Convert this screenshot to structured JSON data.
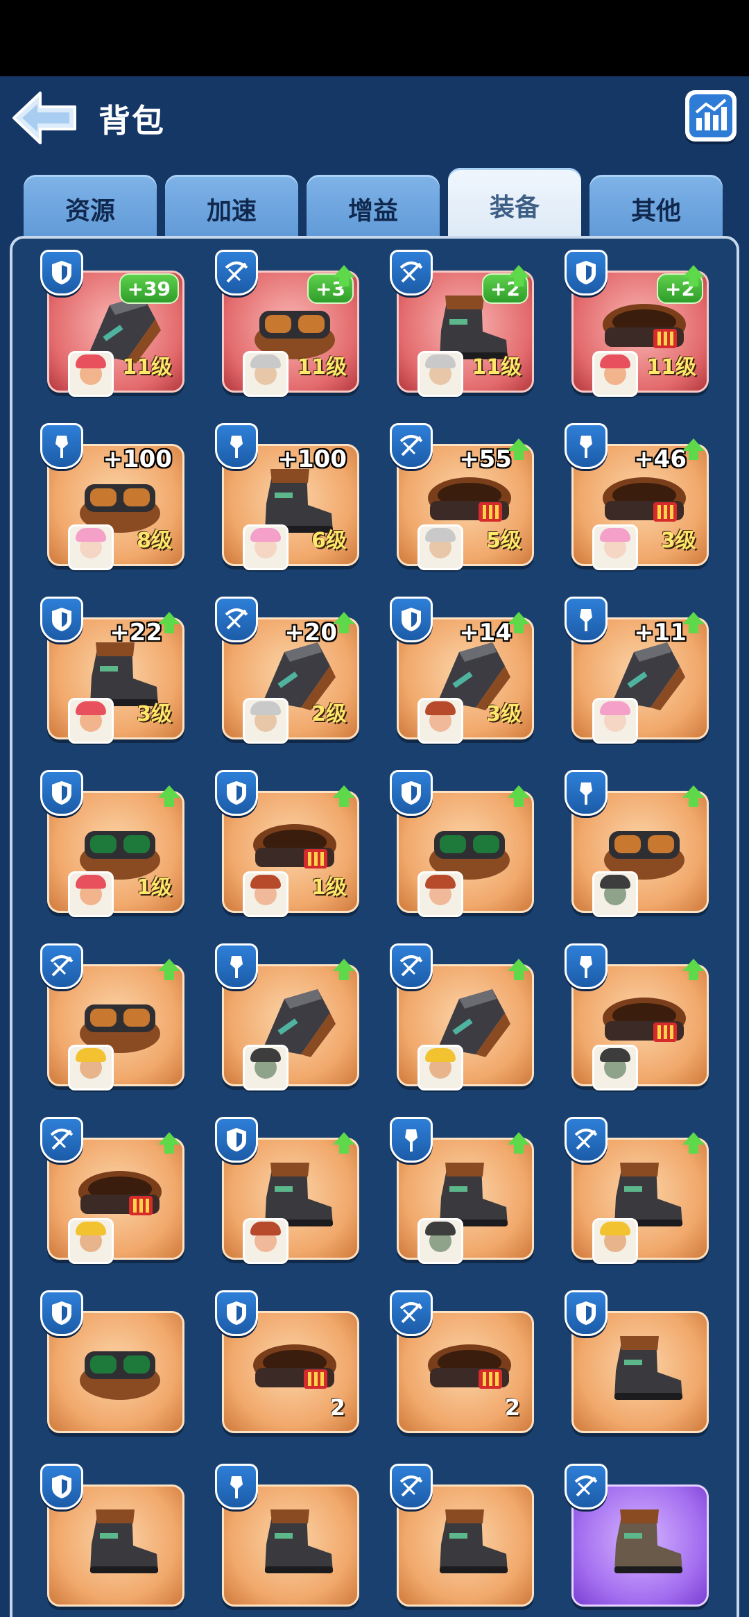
{
  "header": {
    "title": "背包",
    "back_icon": "back-arrow-icon",
    "stats_icon": "bar-chart-icon"
  },
  "tabs": [
    {
      "label": "资源",
      "active": false
    },
    {
      "label": "加速",
      "active": false
    },
    {
      "label": "增益",
      "active": false
    },
    {
      "label": "装备",
      "active": true
    },
    {
      "label": "其他",
      "active": false
    }
  ],
  "colors": {
    "background": "#143766",
    "rarity_red": "#e36a6c",
    "rarity_orange": "#f1a86b",
    "rarity_purple": "#a46ff0",
    "upgrade_green": "#5ed94a",
    "level_yellow": "#ffe76a"
  },
  "items": [
    {
      "slot": "shield",
      "gear": "gauntlet",
      "rarity": "red",
      "bonus": "+39",
      "upgrade": false,
      "hero": "pink-cap",
      "level": "11级"
    },
    {
      "slot": "crossbow",
      "gear": "goggles",
      "rarity": "red",
      "bonus": "+3",
      "upgrade": true,
      "hero": "old-bearded",
      "level": "11级"
    },
    {
      "slot": "crossbow",
      "gear": "boot",
      "rarity": "red",
      "bonus": "+2",
      "upgrade": true,
      "hero": "old-bearded",
      "level": "11级"
    },
    {
      "slot": "shield",
      "gear": "belt",
      "rarity": "red",
      "bonus": "+2",
      "upgrade": true,
      "hero": "pink-cap",
      "level": "11级"
    },
    {
      "slot": "shovel",
      "gear": "goggles",
      "rarity": "orange",
      "bonus": "+100",
      "upgrade": false,
      "hero": "pink-hair",
      "level": "8级"
    },
    {
      "slot": "shovel",
      "gear": "boot",
      "rarity": "orange",
      "bonus": "+100",
      "upgrade": false,
      "hero": "pink-hair",
      "level": "6级"
    },
    {
      "slot": "crossbow",
      "gear": "belt",
      "rarity": "orange",
      "bonus": "+55",
      "upgrade": true,
      "hero": "old-bearded",
      "level": "5级"
    },
    {
      "slot": "shovel",
      "gear": "belt",
      "rarity": "orange",
      "bonus": "+46",
      "upgrade": true,
      "hero": "pink-hair",
      "level": "3级"
    },
    {
      "slot": "shield",
      "gear": "boot",
      "rarity": "orange",
      "bonus": "+22",
      "upgrade": true,
      "hero": "pink-cap",
      "level": "3级"
    },
    {
      "slot": "crossbow",
      "gear": "gauntlet",
      "rarity": "orange",
      "bonus": "+20",
      "upgrade": true,
      "hero": "old-bearded",
      "level": "2级"
    },
    {
      "slot": "shield",
      "gear": "gauntlet",
      "rarity": "orange",
      "bonus": "+14",
      "upgrade": true,
      "hero": "red-hair",
      "level": "3级"
    },
    {
      "slot": "shovel",
      "gear": "gauntlet",
      "rarity": "orange",
      "bonus": "+11",
      "upgrade": true,
      "hero": "pink-hair",
      "level": ""
    },
    {
      "slot": "shield",
      "gear": "goggles-green",
      "rarity": "orange",
      "bonus": "",
      "upgrade": true,
      "hero": "pink-cap",
      "level": "1级"
    },
    {
      "slot": "shield",
      "gear": "belt",
      "rarity": "orange",
      "bonus": "",
      "upgrade": true,
      "hero": "red-hair",
      "level": "1级"
    },
    {
      "slot": "shield",
      "gear": "goggles-green",
      "rarity": "orange",
      "bonus": "",
      "upgrade": true,
      "hero": "red-hair",
      "level": ""
    },
    {
      "slot": "shovel",
      "gear": "goggles",
      "rarity": "orange",
      "bonus": "",
      "upgrade": true,
      "hero": "gas-mask",
      "level": ""
    },
    {
      "slot": "crossbow",
      "gear": "goggles",
      "rarity": "orange",
      "bonus": "",
      "upgrade": true,
      "hero": "yellow-helmet",
      "level": ""
    },
    {
      "slot": "shovel",
      "gear": "gauntlet",
      "rarity": "orange",
      "bonus": "",
      "upgrade": true,
      "hero": "gas-mask",
      "level": ""
    },
    {
      "slot": "crossbow",
      "gear": "gauntlet",
      "rarity": "orange",
      "bonus": "",
      "upgrade": true,
      "hero": "yellow-helmet",
      "level": ""
    },
    {
      "slot": "shovel",
      "gear": "belt",
      "rarity": "orange",
      "bonus": "",
      "upgrade": true,
      "hero": "gas-mask",
      "level": ""
    },
    {
      "slot": "crossbow",
      "gear": "belt",
      "rarity": "orange",
      "bonus": "",
      "upgrade": true,
      "hero": "yellow-helmet",
      "level": ""
    },
    {
      "slot": "shield",
      "gear": "boot",
      "rarity": "orange",
      "bonus": "",
      "upgrade": true,
      "hero": "red-hair",
      "level": ""
    },
    {
      "slot": "shovel",
      "gear": "boot",
      "rarity": "orange",
      "bonus": "",
      "upgrade": true,
      "hero": "gas-mask",
      "level": ""
    },
    {
      "slot": "crossbow",
      "gear": "boot",
      "rarity": "orange",
      "bonus": "",
      "upgrade": true,
      "hero": "yellow-helmet",
      "level": ""
    },
    {
      "slot": "shield",
      "gear": "goggles-green",
      "rarity": "orange",
      "bonus": "",
      "upgrade": false,
      "hero": "",
      "count": ""
    },
    {
      "slot": "shield",
      "gear": "belt",
      "rarity": "orange",
      "bonus": "",
      "upgrade": false,
      "hero": "",
      "count": "2"
    },
    {
      "slot": "crossbow",
      "gear": "belt",
      "rarity": "orange",
      "bonus": "",
      "upgrade": false,
      "hero": "",
      "count": "2"
    },
    {
      "slot": "shield",
      "gear": "boot",
      "rarity": "orange",
      "bonus": "",
      "upgrade": false,
      "hero": "",
      "count": ""
    },
    {
      "slot": "shield",
      "gear": "boot",
      "rarity": "orange",
      "bonus": "",
      "upgrade": false,
      "hero": "",
      "count": ""
    },
    {
      "slot": "shovel",
      "gear": "boot",
      "rarity": "orange",
      "bonus": "",
      "upgrade": false,
      "hero": "",
      "count": ""
    },
    {
      "slot": "crossbow",
      "gear": "boot",
      "rarity": "orange",
      "bonus": "",
      "upgrade": false,
      "hero": "",
      "count": ""
    },
    {
      "slot": "crossbow",
      "gear": "boot-fur",
      "rarity": "purple",
      "bonus": "",
      "upgrade": false,
      "hero": "",
      "count": ""
    }
  ]
}
